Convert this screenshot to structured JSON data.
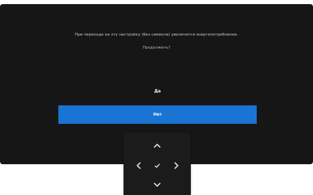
{
  "dialog": {
    "message": "При переходе на эту настройку (без символа) увеличится энергопотребление.",
    "question": "Продолжить?",
    "yes_label": "Да",
    "no_label": "Нет"
  },
  "colors": {
    "screen_bg": "#161616",
    "selected_button": "#1a74d3",
    "text": "#ffffff",
    "nav_pad_bg": "#1b1b1b"
  },
  "nav_pad": {
    "icons": [
      "chevron-up-icon",
      "chevron-left-icon",
      "check-icon",
      "chevron-right-icon",
      "chevron-down-icon"
    ]
  }
}
